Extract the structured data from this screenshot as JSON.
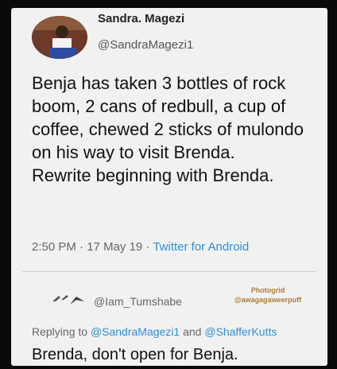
{
  "author": {
    "name": "Sandra. Magezi",
    "handle": "@SandraMagezi1"
  },
  "tweet": {
    "lines": [
      "Benja has taken 3 bottles of rock boom, 2 cans of redbull, a cup of coffee, chewed 2 sticks of mulondo on his way to visit Brenda.",
      "Rewrite beginning with Brenda."
    ]
  },
  "meta": {
    "time": "2:50 PM",
    "sep1": " · ",
    "date": "17 May 19",
    "sep2": " · ",
    "source": "Twitter for Android"
  },
  "reply": {
    "handle": "@Iam_Tumshabe",
    "watermark_line1": "Photogrid",
    "watermark_line2": "@awagagaweerpuff",
    "replying_prefix": "Replying to ",
    "mention1": "@SandraMagezi1",
    "and": " and ",
    "mention2": "@ShafferKutts",
    "text": "Brenda, don't open for Benja."
  }
}
